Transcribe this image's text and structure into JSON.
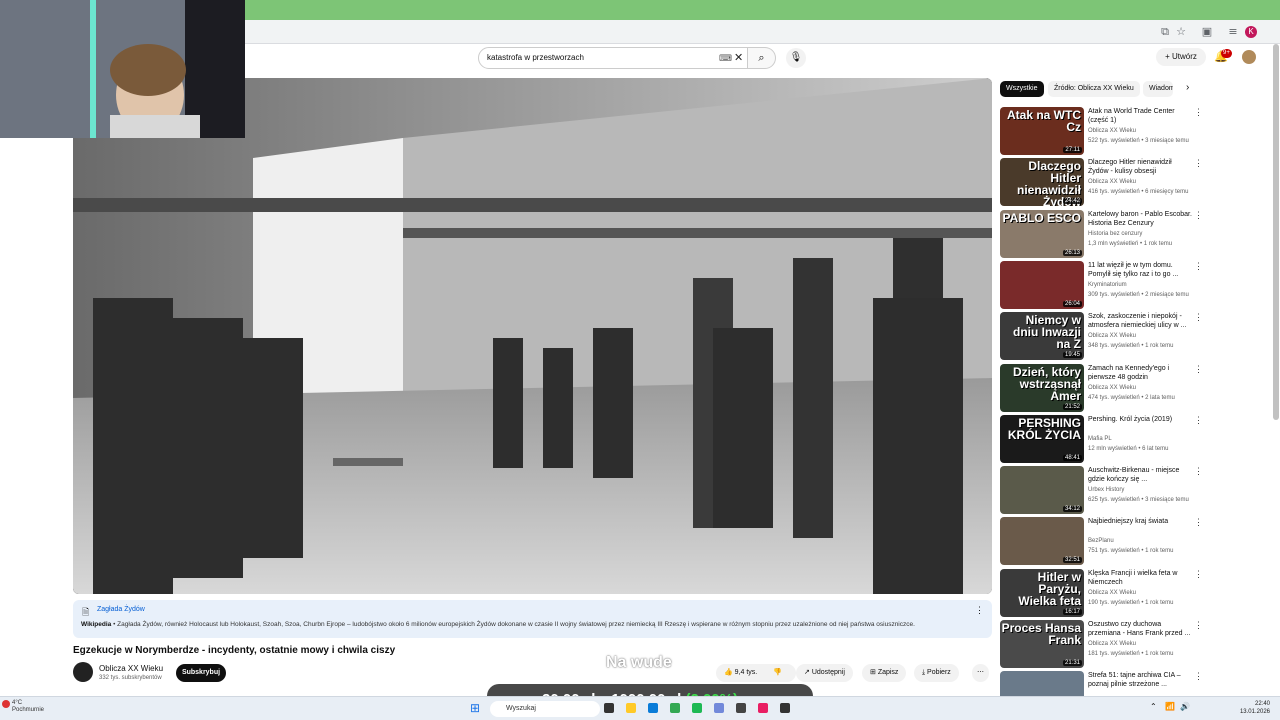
{
  "browser": {
    "profile_initial": "K"
  },
  "search": {
    "query": "katastrofa w przestworzach"
  },
  "header": {
    "create_label": "Utwórz",
    "notifications_badge": "9+"
  },
  "video": {
    "title": "Egzekucje w Norymberdze - incydenty, ostatnie mowy i chwila ciszy",
    "channel": "Oblicza XX Wieku",
    "subscribers": "332 tys. subskrybentów",
    "subscribe_label": "Subskrybuj",
    "likes": "9,4 tys.",
    "share_label": "Udostępnij",
    "save_label": "Zapisz",
    "download_label": "Pobierz"
  },
  "wiki": {
    "title": "Zagłada Żydów",
    "source": "Wikipedia",
    "text": " • Zagłada Żydów, również Holocaust lub Holokaust, Szoah, Szoa, Churbn Ejrope – ludobójstwo około 6 milionów europejskich Żydów dokonane w czasie II wojny światowej przez niemiecką III Rzeszę i wspierane w różnym stopniu przez uzależnione od niej państwa osiuszniczce."
  },
  "overlay": {
    "caption": "Na wude",
    "price_from": "20,00 zł",
    "price_sep": "z",
    "price_to": "1000,00 zł",
    "price_pct": "(2.00%)"
  },
  "chips": [
    "Wszystkie",
    "Źródło: Oblicza XX Wieku",
    "Wiadom"
  ],
  "sidebar": [
    {
      "title": "Atak na World Trade Center (część 1)",
      "channel": "Oblicza XX Wieku",
      "meta": "522 tys. wyświetleń • 3 miesiące temu",
      "duration": "27:11",
      "thumb_text": "Atak na WTC Cz",
      "color": "#6b2d1e"
    },
    {
      "title": "Dlaczego Hitler nienawidził Żydów - kulisy obsesji",
      "channel": "Oblicza XX Wieku",
      "meta": "416 tys. wyświetleń • 6 miesięcy temu",
      "duration": "24:42",
      "thumb_text": "Dlaczego Hitler nienawidził Żydów",
      "color": "#4a3a2a"
    },
    {
      "title": "Kartelowy baron - Pablo Escobar. Historia Bez Cenzury",
      "channel": "Historia bez cenzury",
      "meta": "1,3 mln wyświetleń • 1 rok temu",
      "duration": "26:13",
      "thumb_text": "PABLO ESCO",
      "color": "#8a7a6a"
    },
    {
      "title": "11 lat więził je w tym domu. Pomylił się tylko raz i to go ...",
      "channel": "Kryminatorium",
      "meta": "309 tys. wyświetleń • 2 miesiące temu",
      "duration": "26:04",
      "thumb_text": "",
      "color": "#7a2a2a"
    },
    {
      "title": "Szok, zaskoczenie i niepokój - atmosfera niemieckiej ulicy w ...",
      "channel": "Oblicza XX Wieku",
      "meta": "348 tys. wyświetleń • 1 rok temu",
      "duration": "19:45",
      "thumb_text": "Niemcy w dniu Inwazji na Z",
      "color": "#3a3a3a"
    },
    {
      "title": "Zamach na Kennedy'ego i pierwsze 48 godzin",
      "channel": "Oblicza XX Wieku",
      "meta": "474 tys. wyświetleń • 2 lata temu",
      "duration": "21:52",
      "thumb_text": "Dzień, który wstrząsnął Amer",
      "color": "#2a3a2a"
    },
    {
      "title": "Pershing. Król życia (2019)",
      "channel": "Mafia PL",
      "meta": "12 mln wyświetleń • 6 lat temu",
      "duration": "48:41",
      "thumb_text": "PERSHING KRÓL ŻYCIA",
      "color": "#1a1a1a"
    },
    {
      "title": "Auschwitz-Birkenau - miejsce gdzie kończy się ...",
      "channel": "Urbex History",
      "meta": "625 tys. wyświetleń • 3 miesiące temu",
      "duration": "34:12",
      "thumb_text": "",
      "color": "#5a5a4a"
    },
    {
      "title": "Najbiedniejszy kraj świata",
      "channel": "BezPlanu",
      "meta": "751 tys. wyświetleń • 1 rok temu",
      "duration": "32:51",
      "thumb_text": "",
      "color": "#6a5a4a"
    },
    {
      "title": "Klęska Francji i wielka feta w Niemczech",
      "channel": "Oblicza XX Wieku",
      "meta": "190 tys. wyświetleń • 1 rok temu",
      "duration": "16:17",
      "thumb_text": "Hitler w Paryżu, Wielka feta",
      "color": "#3a3a3a"
    },
    {
      "title": "Oszustwo czy duchowa przemiana - Hans Frank przed ...",
      "channel": "Oblicza XX Wieku",
      "meta": "181 tys. wyświetleń • 1 rok temu",
      "duration": "21:31",
      "thumb_text": "Proces Hansa Frank",
      "color": "#4a4a4a"
    },
    {
      "title": "Strefa 51: tajne archiwa CIA – poznaj pilnie strzeżone ...",
      "channel": "",
      "meta": "",
      "duration": "",
      "thumb_text": "",
      "color": "#6a7a8a"
    }
  ],
  "taskbar": {
    "weather_temp": "4°C",
    "weather_desc": "Pochmurnie",
    "search_label": "Wyszukaj",
    "time": "22:40",
    "date": "13.01.2026"
  }
}
